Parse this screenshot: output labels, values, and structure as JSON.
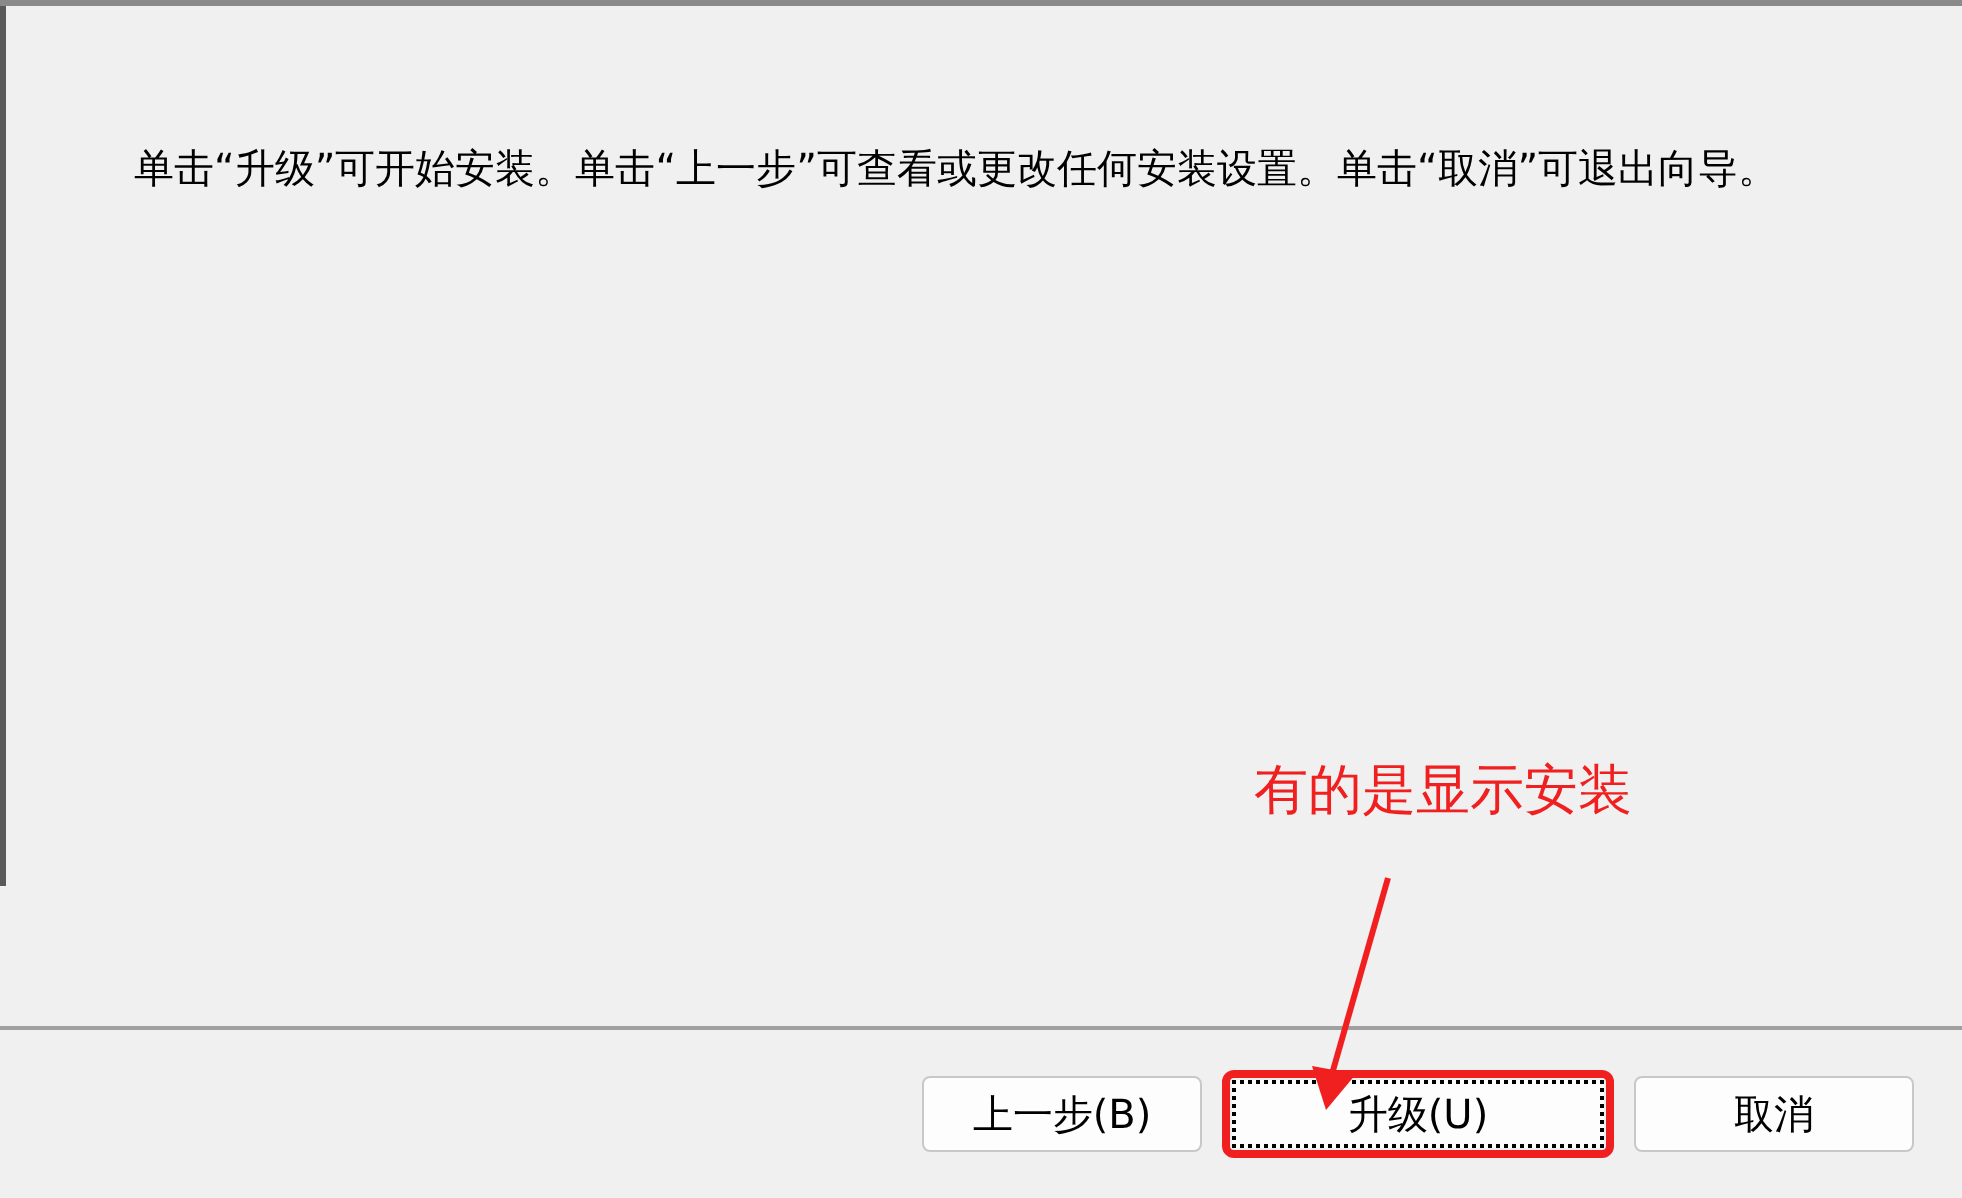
{
  "description": "单击“升级”可开始安装。单击“上一步”可查看或更改任何安装设置。单击“取消”可退出向导。",
  "buttons": [
    {
      "label": "上一步(B)",
      "focused": false
    },
    {
      "label": "升级(U)",
      "focused": true
    },
    {
      "label": "取消",
      "focused": false
    }
  ],
  "annotation": {
    "text": "有的是显示安装"
  }
}
